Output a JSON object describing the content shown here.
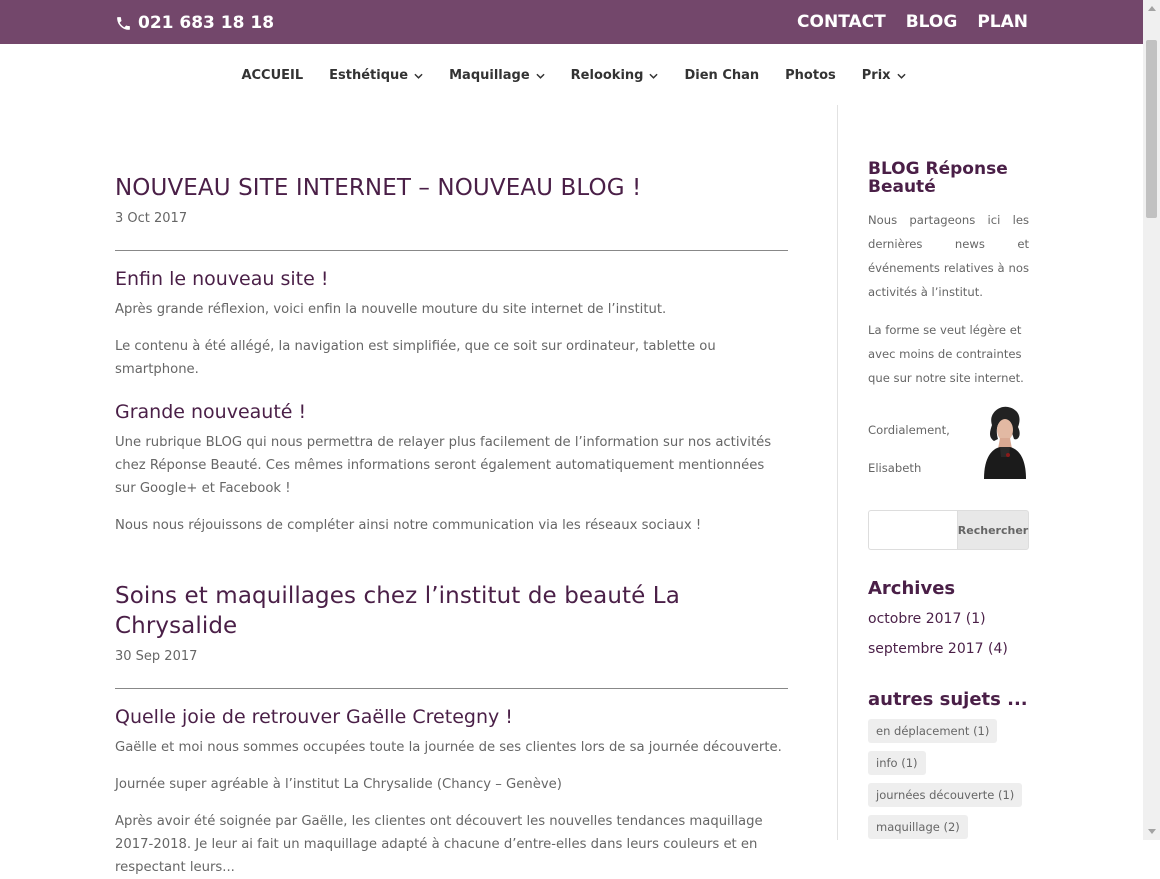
{
  "topbar": {
    "phone": "021 683 18 18",
    "links": [
      "CONTACT",
      "BLOG",
      "PLAN"
    ]
  },
  "nav": {
    "items": [
      {
        "label": "ACCUEIL",
        "dropdown": false
      },
      {
        "label": "Esthétique",
        "dropdown": true
      },
      {
        "label": "Maquillage",
        "dropdown": true
      },
      {
        "label": "Relooking",
        "dropdown": true
      },
      {
        "label": "Dien Chan",
        "dropdown": false
      },
      {
        "label": "Photos",
        "dropdown": false
      },
      {
        "label": "Prix",
        "dropdown": true
      }
    ]
  },
  "posts": [
    {
      "title": "NOUVEAU SITE INTERNET – NOUVEAU BLOG !",
      "date": "3 Oct 2017",
      "h1": "Enfin le nouveau site !",
      "p1": "Après grande réflexion, voici enfin la nouvelle mouture du site internet de l’institut.",
      "p2": "Le contenu à été allégé, la navigation est simplifiée, que ce soit sur ordinateur, tablette ou smartphone.",
      "h2": "Grande nouveauté !",
      "p3": "Une rubrique BLOG qui nous permettra de relayer plus facilement de l’information sur nos activités chez Réponse Beauté. Ces mêmes informations seront également automatiquement mentionnées sur Google+ et Facebook !",
      "p4": "Nous nous réjouissons de compléter ainsi notre communication via les réseaux sociaux !"
    },
    {
      "title": "Soins et maquillages chez l’institut de beauté La Chrysalide",
      "date": "30 Sep 2017",
      "h1": "Quelle joie de retrouver Gaëlle Cretegny !",
      "p1": "Gaëlle et moi nous sommes occupées toute la journée de ses clientes lors de sa journée découverte.",
      "p2": "Journée super agréable à l’institut La Chrysalide (Chancy – Genève)",
      "p3": "Après avoir été soignée par Gaëlle, les clientes ont découvert les nouvelles tendances maquillage 2017-2018. Je leur ai fait un maquillage adapté à chacune d’entre-elles dans leurs couleurs et en respectant leurs..."
    }
  ],
  "sidebar": {
    "title": "BLOG Réponse Beauté",
    "intro": "Nous partageons ici les dernières news et événements relatives à nos activités à l’institut.",
    "text2": "La forme se veut légère et avec moins de contraintes que sur notre site internet.",
    "greeting": "Cordialement,",
    "signature": "Elisabeth",
    "search_button": "Rechercher",
    "archives_title": "Archives",
    "archives": [
      "octobre 2017 (1)",
      "septembre 2017 (4)"
    ],
    "topics_title": "autres sujets ...",
    "tags": [
      "en déplacement (1)",
      "info (1)",
      "journées découverte (1)",
      "maquillage (2)"
    ]
  },
  "colors": {
    "topbar": "#73476b",
    "heading": "#4a1f47"
  }
}
